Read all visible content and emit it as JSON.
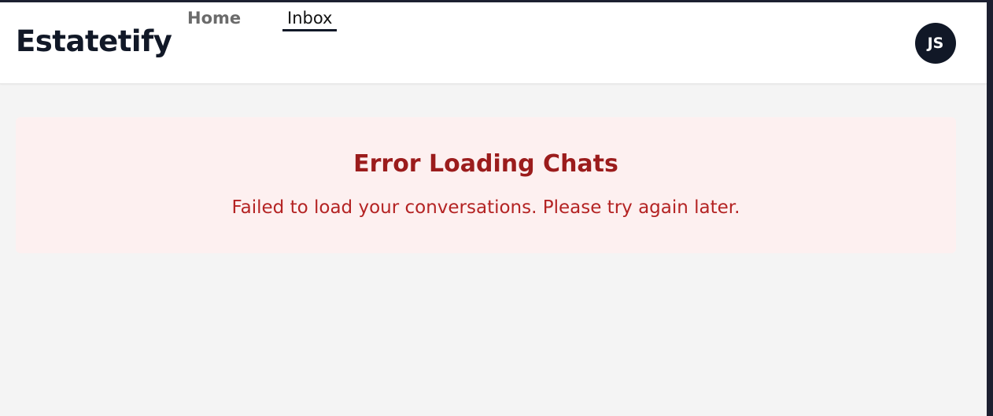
{
  "app": {
    "brand": "Estatetify"
  },
  "nav": {
    "tabs": [
      {
        "label": "Home",
        "active": false
      },
      {
        "label": "Inbox",
        "active": true
      }
    ]
  },
  "user": {
    "initials": "JS"
  },
  "error": {
    "title": "Error Loading Chats",
    "message": "Failed to load your conversations. Please try again later."
  },
  "colors": {
    "brand_text": "#111827",
    "error_title": "#9b1c1c",
    "error_message": "#b42323",
    "error_background": "#fdf0f0",
    "page_background": "#f4f4f4"
  }
}
